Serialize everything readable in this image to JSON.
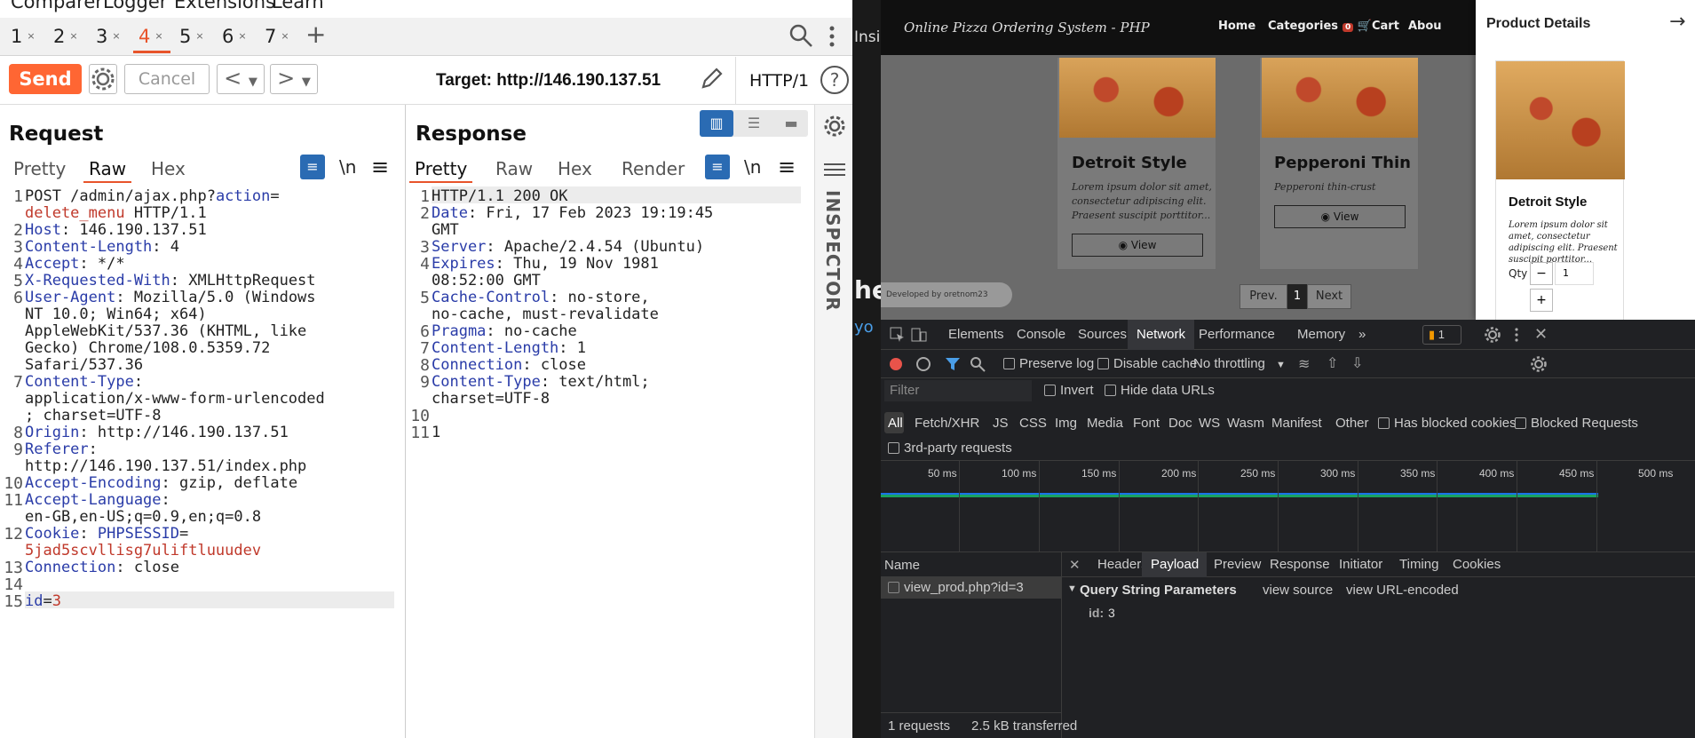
{
  "menubar": [
    "Comparer",
    "Logger",
    "Extensions",
    "Learn"
  ],
  "repeater_tabs": [
    {
      "label": "1",
      "close": "×"
    },
    {
      "label": "2",
      "close": "×"
    },
    {
      "label": "3",
      "close": "×"
    },
    {
      "label": "4",
      "close": "×",
      "active": true
    },
    {
      "label": "5",
      "close": "×"
    },
    {
      "label": "6",
      "close": "×"
    },
    {
      "label": "7",
      "close": "×"
    }
  ],
  "toolbar": {
    "send": "Send",
    "cancel": "Cancel",
    "target": "Target: http://146.190.137.51",
    "protocol": "HTTP/1",
    "help": "?"
  },
  "request": {
    "title": "Request",
    "tabs": [
      "Pretty",
      "Raw",
      "Hex"
    ],
    "active_tab": "Raw",
    "newline_label": "\\n",
    "lines": [
      {
        "n": "1",
        "k": "",
        "v": "POST /admin/ajax.php?",
        "p": "action",
        "e": "=",
        "r": ""
      },
      {
        "n": "",
        "k": "",
        "v": "",
        "p": "",
        "e": "",
        "r": "delete_menu",
        "tail": " HTTP/1.1"
      },
      {
        "n": "2",
        "k": "Host",
        "v": ": 146.190.137.51"
      },
      {
        "n": "3",
        "k": "Content-Length",
        "v": ": 4"
      },
      {
        "n": "4",
        "k": "Accept",
        "v": ": */*"
      },
      {
        "n": "5",
        "k": "X-Requested-With",
        "v": ": XMLHttpRequest"
      },
      {
        "n": "6",
        "k": "User-Agent",
        "v": ": Mozilla/5.0 (Windows"
      },
      {
        "n": "",
        "k": "",
        "v": "NT 10.0; Win64; x64)"
      },
      {
        "n": "",
        "k": "",
        "v": "AppleWebKit/537.36 (KHTML, like"
      },
      {
        "n": "",
        "k": "",
        "v": "Gecko) Chrome/108.0.5359.72"
      },
      {
        "n": "",
        "k": "",
        "v": "Safari/537.36"
      },
      {
        "n": "7",
        "k": "Content-Type",
        "v": ":"
      },
      {
        "n": "",
        "k": "",
        "v": "application/x-www-form-urlencoded"
      },
      {
        "n": "",
        "k": "",
        "v": "; charset=UTF-8"
      },
      {
        "n": "8",
        "k": "Origin",
        "v": ": http://146.190.137.51"
      },
      {
        "n": "9",
        "k": "Referer",
        "v": ":"
      },
      {
        "n": "",
        "k": "",
        "v": "http://146.190.137.51/index.php"
      },
      {
        "n": "10",
        "k": "Accept-Encoding",
        "v": ": gzip, deflate"
      },
      {
        "n": "11",
        "k": "Accept-Language",
        "v": ":"
      },
      {
        "n": "",
        "k": "",
        "v": "en-GB,en-US;q=0.9,en;q=0.8"
      },
      {
        "n": "12",
        "k": "Cookie",
        "v": ": ",
        "p": "PHPSESSID",
        "e": "=",
        "r": ""
      },
      {
        "n": "",
        "k": "",
        "v": "",
        "r": "5jad5scvllisg7uliftluuudev"
      },
      {
        "n": "13",
        "k": "Connection",
        "v": ": close"
      },
      {
        "n": "14",
        "k": "",
        "v": ""
      },
      {
        "n": "15",
        "k": "",
        "v": "",
        "p": "id",
        "e": "=",
        "r": "3"
      }
    ]
  },
  "response": {
    "title": "Response",
    "tabs": [
      "Pretty",
      "Raw",
      "Hex",
      "Render"
    ],
    "active_tab": "Pretty",
    "newline_label": "\\n",
    "lines": [
      {
        "n": "1",
        "k": "",
        "v": "HTTP/1.1 200 OK"
      },
      {
        "n": "2",
        "k": "Date",
        "v": ": Fri, 17 Feb 2023 19:19:45"
      },
      {
        "n": "",
        "k": "",
        "v": "GMT"
      },
      {
        "n": "3",
        "k": "Server",
        "v": ": Apache/2.4.54 (Ubuntu)"
      },
      {
        "n": "4",
        "k": "Expires",
        "v": ": Thu, 19 Nov 1981"
      },
      {
        "n": "",
        "k": "",
        "v": "08:52:00 GMT"
      },
      {
        "n": "5",
        "k": "Cache-Control",
        "v": ": no-store,"
      },
      {
        "n": "",
        "k": "",
        "v": "no-cache, must-revalidate"
      },
      {
        "n": "6",
        "k": "Pragma",
        "v": ": no-cache"
      },
      {
        "n": "7",
        "k": "Content-Length",
        "v": ": 1"
      },
      {
        "n": "8",
        "k": "Connection",
        "v": ": close"
      },
      {
        "n": "9",
        "k": "Content-Type",
        "v": ": text/html;"
      },
      {
        "n": "",
        "k": "",
        "v": "charset=UTF-8"
      },
      {
        "n": "10",
        "k": "",
        "v": ""
      },
      {
        "n": "11",
        "k": "",
        "v": "1"
      }
    ]
  },
  "inspector_label": "INSPECTOR",
  "website": {
    "brand": "Online Pizza Ordering System - PHP",
    "nav": [
      "Home",
      "Categories",
      "Cart",
      "Abou"
    ],
    "cart_count": "0",
    "side_fragments": [
      "Insi",
      "he",
      "yo"
    ],
    "cards": [
      {
        "title": "Detroit Style",
        "desc": "Lorem ipsum dolor sit amet, consectetur adipiscing elit. Praesent suscipit porttitor...",
        "view": "View"
      },
      {
        "title": "Pepperoni Thin",
        "desc": "Pepperoni thin-crust",
        "view": "View"
      }
    ],
    "developed_by": "Developed by oretnom23",
    "pager": [
      "Prev.",
      "1",
      "Next"
    ],
    "drawer": {
      "title": "Product Details",
      "product_name": "Detroit Style",
      "product_desc": "Lorem ipsum dolor sit amet, consectetur adipiscing elit. Praesent suscipit porttitor...",
      "qty_label": "Qty",
      "qty_value": "1",
      "minus": "−",
      "plus": "+"
    }
  },
  "devtools": {
    "tabs": [
      "Elements",
      "Console",
      "Sources",
      "Network",
      "Performance",
      "Memory"
    ],
    "active_tab": "Network",
    "more": "»",
    "issues_count": "1",
    "preserve_log": "Preserve log",
    "disable_cache": "Disable cache",
    "throttling": "No throttling",
    "filter_placeholder": "Filter",
    "invert": "Invert",
    "hide_data_urls": "Hide data URLs",
    "types": [
      "All",
      "Fetch/XHR",
      "JS",
      "CSS",
      "Img",
      "Media",
      "Font",
      "Doc",
      "WS",
      "Wasm",
      "Manifest",
      "Other"
    ],
    "has_blocked_cookies": "Has blocked cookies",
    "blocked_requests": "Blocked Requests",
    "third_party": "3rd-party requests",
    "ticks": [
      "50 ms",
      "100 ms",
      "150 ms",
      "200 ms",
      "250 ms",
      "300 ms",
      "350 ms",
      "400 ms",
      "450 ms",
      "500 ms"
    ],
    "name_header": "Name",
    "request_name": "view_prod.php?id=3",
    "subtabs": [
      "Headers",
      "Payload",
      "Preview",
      "Response",
      "Initiator",
      "Timing",
      "Cookies"
    ],
    "active_subtab": "Payload",
    "qsp_title": "Query String Parameters",
    "view_source": "view source",
    "view_url_encoded": "view URL-encoded",
    "param_key": "id:",
    "param_value": "3",
    "status_requests": "1 requests",
    "status_transferred": "2.5 kB transferred"
  },
  "colors": {
    "accent": "#ff6633",
    "request_key": "#2a3ca8",
    "value_red": "#c0392b",
    "devtools_bg": "#202124",
    "timeline_green": "#1aa260",
    "timeline_blue": "#1a73e8"
  }
}
